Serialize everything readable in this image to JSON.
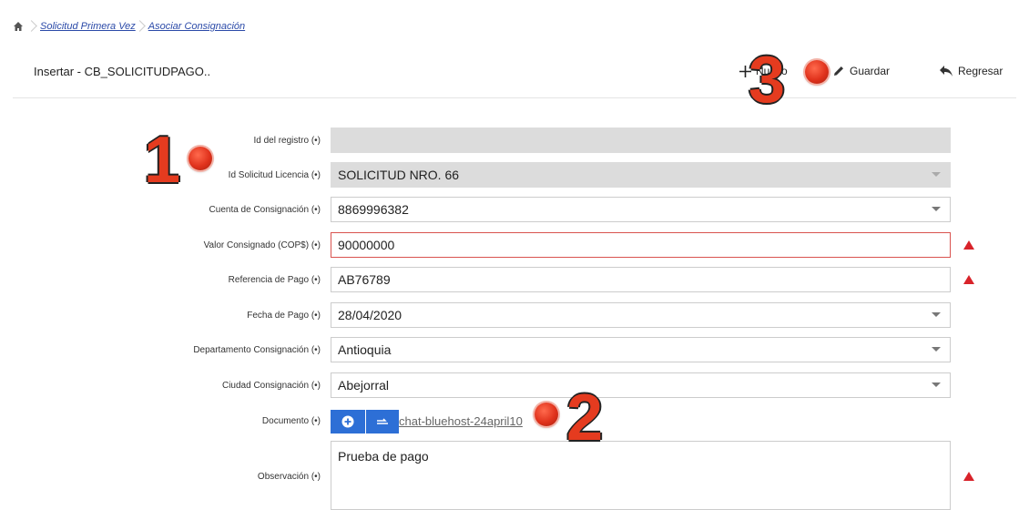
{
  "breadcrumb": {
    "items": [
      "Solicitud Primera Vez",
      "Asociar Consignación"
    ]
  },
  "header": {
    "title": "Insertar - CB_SOLICITUDPAGO..",
    "new_label": "Nuevo",
    "save_label": "Guardar",
    "back_label": "Regresar"
  },
  "form": {
    "id_registro": {
      "label": "Id del registro (•)",
      "value": ""
    },
    "id_solicitud": {
      "label": "Id Solicitud Licencia (•)",
      "value": "SOLICITUD NRO. 66"
    },
    "cuenta": {
      "label": "Cuenta de Consignación (•)",
      "value": "8869996382"
    },
    "valor": {
      "label": "Valor Consignado (COP$) (•)",
      "value": "90000000"
    },
    "referencia": {
      "label": "Referencia de Pago (•)",
      "value": "AB76789"
    },
    "fecha": {
      "label": "Fecha de Pago (•)",
      "value": "28/04/2020"
    },
    "departamento": {
      "label": "Departamento Consignación (•)",
      "value": "Antioquia"
    },
    "ciudad": {
      "label": "Ciudad Consignación (•)",
      "value": "Abejorral"
    },
    "documento": {
      "label": "Documento (•)",
      "file": "chat-bluehost-24april10"
    },
    "observacion": {
      "label": "Observación (•)",
      "value": "Prueba de pago"
    }
  },
  "annotations": {
    "n1": "1",
    "n2": "2",
    "n3": "3"
  },
  "icons": [
    "home-icon",
    "plus-icon",
    "pencil-icon",
    "reply-icon",
    "add-circle-icon",
    "upload-icon",
    "warning-icon"
  ],
  "colors": {
    "accent": "#2d6fd6",
    "error": "#d8232a",
    "link": "#2b4aa8"
  }
}
